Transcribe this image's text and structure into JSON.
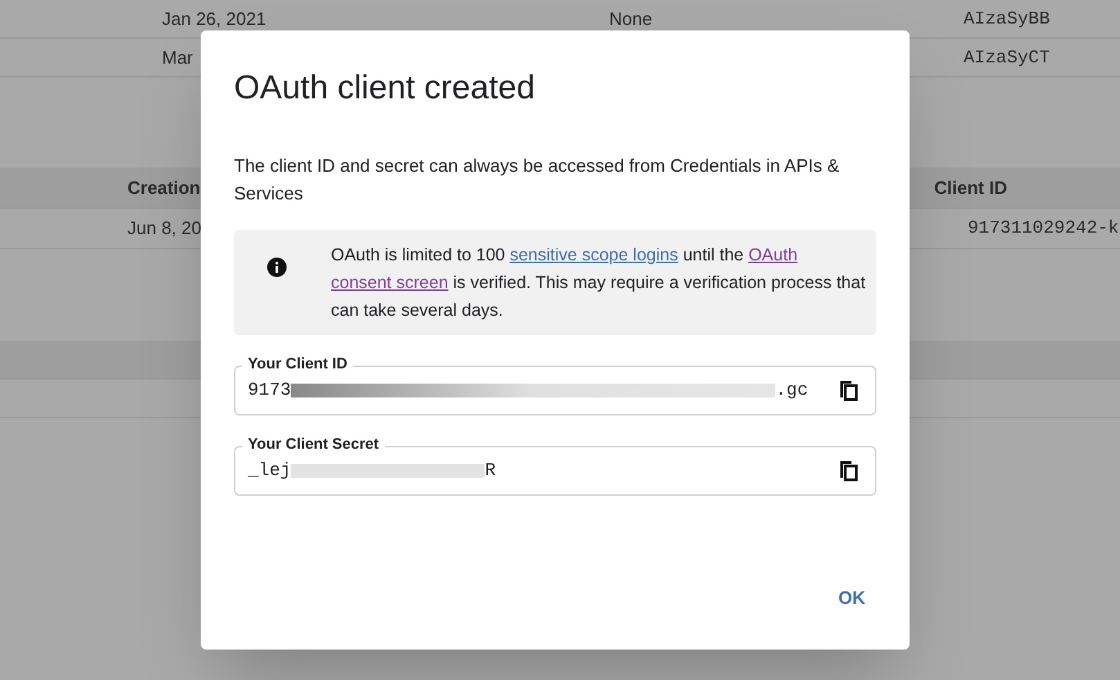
{
  "background_table": {
    "top_rows": [
      {
        "date": "Jan 26, 2021",
        "column_2": "None",
        "key": "AIzaSyBB"
      },
      {
        "date": "Mar",
        "column_2": "",
        "key": "AIzaSyCT"
      }
    ],
    "header": {
      "column_1": "Creation",
      "column_2": "Client ID"
    },
    "rows": [
      {
        "date": "Jun 8, 20",
        "client_id": "917311029242-k"
      }
    ]
  },
  "dialog": {
    "title": "OAuth client created",
    "description": "The client ID and secret can always be accessed from Credentials in APIs & Services",
    "notice": {
      "before": "OAuth is limited to 100 ",
      "link_1": "sensitive scope logins",
      "middle": " until the ",
      "link_2": [
        "OAuth",
        "consent screen"
      ],
      "after": " is verified. This may require a verification process that can take several days."
    },
    "fields": [
      {
        "label": "Your Client ID",
        "value_start": "9173",
        "value_end": ".gc",
        "redacted": true
      },
      {
        "label": "Your Client Secret",
        "value_start": "_lej",
        "value_end": "R",
        "redacted": true
      }
    ],
    "buttons": [
      "OK"
    ]
  }
}
